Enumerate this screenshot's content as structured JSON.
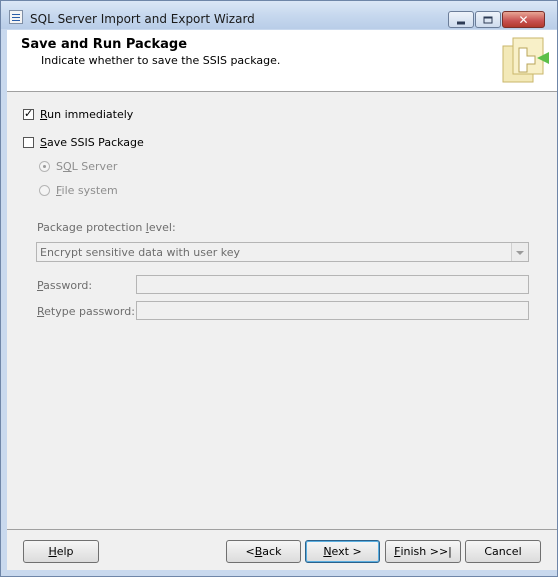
{
  "window": {
    "title": "SQL Server Import and Export Wizard"
  },
  "header": {
    "title": "Save and Run Package",
    "subtitle": "Indicate whether to save the SSIS package."
  },
  "options": {
    "run_immediately": {
      "pre": "",
      "accel": "R",
      "post": "un immediately",
      "checked": true
    },
    "save_ssis": {
      "pre": "",
      "accel": "S",
      "post": "ave SSIS Package",
      "checked": false
    },
    "sql_server": {
      "pre": "S",
      "accel": "Q",
      "post": "L Server",
      "selected": true,
      "enabled": false
    },
    "file_system": {
      "pre": "",
      "accel": "F",
      "post": "ile system",
      "selected": false,
      "enabled": false
    }
  },
  "protection": {
    "label_pre": "Package protection ",
    "label_accel": "l",
    "label_post": "evel:",
    "value": "Encrypt sensitive data with user key"
  },
  "password": {
    "accel": "P",
    "post": "assword:",
    "value": ""
  },
  "retype": {
    "accel": "R",
    "post": "etype password:",
    "value": ""
  },
  "buttons": {
    "help": {
      "accel": "H",
      "post": "elp"
    },
    "back": {
      "pre": "< ",
      "accel": "B",
      "post": "ack"
    },
    "next": {
      "accel": "N",
      "post": "ext >"
    },
    "finish": {
      "accel": "F",
      "post": "inish >>|"
    },
    "cancel": {
      "label": "Cancel"
    }
  }
}
